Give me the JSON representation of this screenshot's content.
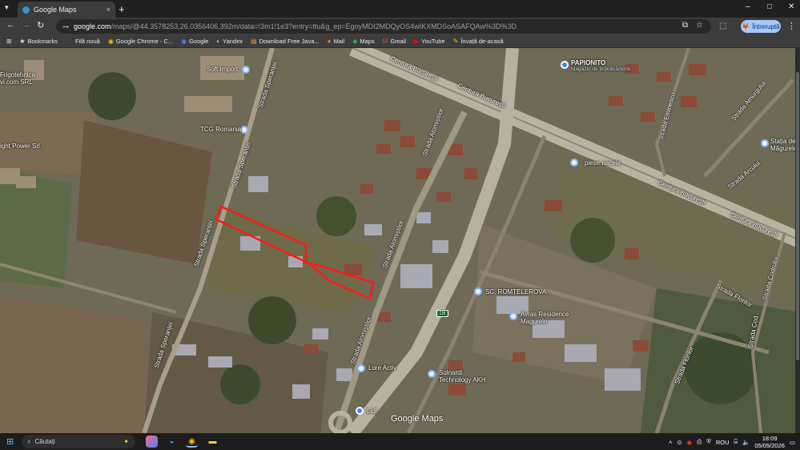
{
  "browser": {
    "tab_title": "Google Maps",
    "new_tab": "+",
    "close_tab": "×",
    "url_host": "google.com",
    "url_path": "/maps/@44.3578253,26.0356406,392m/data=!3m1!1e3?entry=ttu&g_ep=EgoyMDI2MDQyOS4wIKXMDSoASAFQAw%3D%3D",
    "profile_label": "Întreruptă",
    "window_controls": [
      "–",
      "□",
      "✕"
    ]
  },
  "bookmarks": [
    {
      "icon": "star-icon",
      "label": "Bookmarks"
    },
    {
      "icon": "page-icon",
      "label": "Filă nouă"
    },
    {
      "icon": "chrome-icon",
      "label": "Google Chrome - C..."
    },
    {
      "icon": "google-icon",
      "label": "Google"
    },
    {
      "icon": "yandex-icon",
      "label": "Yandex"
    },
    {
      "icon": "java-icon",
      "label": "Download Free Java..."
    },
    {
      "icon": "mail-icon",
      "label": "Mail"
    },
    {
      "icon": "maps-icon",
      "label": "Maps"
    },
    {
      "icon": "gmail-icon",
      "label": "Gmail"
    },
    {
      "icon": "youtube-icon",
      "label": "YouTube"
    },
    {
      "icon": "learn-icon",
      "label": "Învață de-acasă"
    }
  ],
  "map": {
    "places": [
      {
        "name": "Soft Import"
      },
      {
        "name": "TCG Romania"
      },
      {
        "name": "Frigotehnica\nvi.com SRL"
      },
      {
        "name": "ight Power Srl"
      },
      {
        "name": "PAPIONITO",
        "sub": "Magazin de îmbrăcăminte"
      },
      {
        "name": "Stația de\nMăgurele"
      },
      {
        "name": "piese nacele"
      },
      {
        "name": "SC. ROMTELEROVA"
      },
      {
        "name": "Avras Residence\nMagurele"
      },
      {
        "name": "Lore Activ"
      },
      {
        "name": "Solnardi\nTechnology AKH"
      },
      {
        "name": "Lidl"
      }
    ],
    "roads": [
      {
        "name": "Centura București"
      },
      {
        "name": "Centura București"
      },
      {
        "name": "Centura București"
      },
      {
        "name": "Centura București"
      },
      {
        "name": "Strada Atomiștilor"
      },
      {
        "name": "Strada Atomiștilor"
      },
      {
        "name": "Strada Atomiștilor"
      },
      {
        "name": "Strada Speranței"
      },
      {
        "name": "Strada Speranței"
      },
      {
        "name": "Strada Speranței"
      },
      {
        "name": "Strada Speranței"
      },
      {
        "name": "Strada Florilor"
      },
      {
        "name": "Strada Florilor"
      },
      {
        "name": "Strada Arcului"
      },
      {
        "name": "Strada Amurgului"
      },
      {
        "name": "Strada Eminescu"
      },
      {
        "name": "Strada Codrului"
      },
      {
        "name": "Strada Cod..."
      }
    ],
    "route_badge": "1B",
    "logo": "Google Maps"
  },
  "taskbar": {
    "search_placeholder": "Căutați",
    "language": "ROU",
    "time": "18:09",
    "date": "05/05/2026"
  }
}
